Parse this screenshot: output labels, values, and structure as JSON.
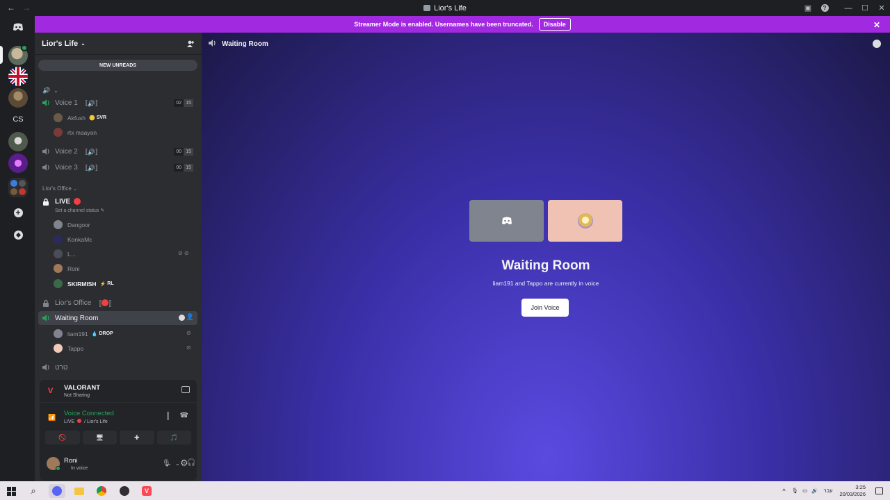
{
  "window": {
    "title": "Lior's Life"
  },
  "banner": {
    "text": "Streamer Mode is enabled. Usernames have been truncated.",
    "disable_label": "Disable"
  },
  "sidebar": {
    "guild_name": "Lior's Life",
    "new_unreads": "NEW UNREADS",
    "voice1": {
      "name": "Voice 1",
      "tag": "〚🔊〛",
      "count_a": "02",
      "count_b": "15"
    },
    "voice1_users": [
      {
        "name": "Akfush",
        "tag": "SVR"
      },
      {
        "name": "rtx maayan"
      }
    ],
    "voice2": {
      "name": "Voice 2",
      "tag": "〚🔊〛",
      "count_a": "00",
      "count_b": "15"
    },
    "voice3": {
      "name": "Voice 3",
      "tag": "〚🔊〛",
      "count_a": "00",
      "count_b": "15"
    },
    "category_office": "Lior's Office",
    "live": {
      "name": "LIVE",
      "status": "Set a channel status"
    },
    "live_users": [
      {
        "name": "Dangoor"
      },
      {
        "name": "KonkaMc"
      },
      {
        "name": "L..."
      },
      {
        "name": "Roni"
      },
      {
        "name": "SKIRMISH",
        "tag": "RL"
      }
    ],
    "office_channel": {
      "name": "Lior's Office"
    },
    "waiting_room": {
      "name": "Waiting Room"
    },
    "waiting_users": [
      {
        "name": "liam191",
        "tag": "DROP"
      },
      {
        "name": "Tappo"
      }
    ],
    "hebrew_channel": "טרט"
  },
  "activity": {
    "game": "VALORANT",
    "status": "Not Sharing"
  },
  "voice_status": {
    "title": "Voice Connected",
    "live": "LIVE",
    "server": "/ Lior's Life"
  },
  "user_panel": {
    "name": "Roni",
    "status": "In voice"
  },
  "main": {
    "channel_name": "Waiting Room",
    "heading": "Waiting Room",
    "subtitle": "liam191 and Tappo are currently in voice",
    "join_label": "Join Voice"
  },
  "tray": {
    "lang": "עבר",
    "time": "3:25",
    "date": "20/03/2026"
  },
  "colors": {
    "brand": "#5865f2",
    "streamer_banner": "#a12ae0",
    "green": "#23a55a",
    "red": "#f23f43"
  }
}
